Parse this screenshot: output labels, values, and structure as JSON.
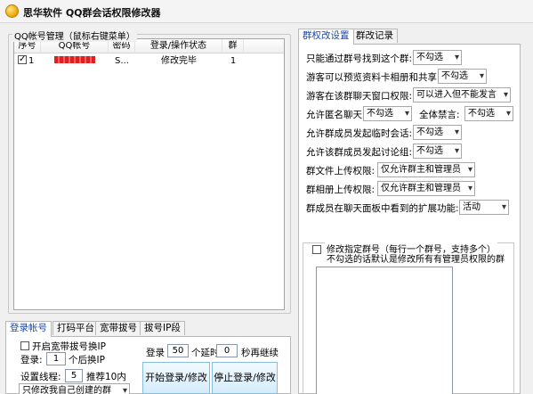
{
  "window": {
    "title": "思华软件 QQ群会话权限修改器",
    "icon": "app-logo-icon"
  },
  "accounts": {
    "group_title": "QQ帐号管理（鼠标右键菜单）",
    "columns": [
      "序号",
      "QQ帐号",
      "密码",
      "登录/操作状态",
      "群"
    ],
    "rows": [
      {
        "index": "1",
        "checked": true,
        "account": "(redacted)",
        "password": "S...",
        "status": "修改完毕",
        "groups": "1"
      }
    ]
  },
  "bottom_tabs": {
    "tabs": [
      "登录帐号",
      "打码平台",
      "宽带拔号",
      "拔号IP段"
    ],
    "active": 0,
    "dial_checkbox_label": "开启宽带拔号换IP",
    "login_label": "登录:",
    "login_value": "1",
    "login_suffix": "个后换IP",
    "threads_label": "设置线程:",
    "threads_value": "5",
    "threads_hint": "推荐10内",
    "group_scope_select": "只修改我自己创建的群",
    "login_count_label": "登录",
    "login_count_value": "50",
    "delay_label": "个延时",
    "delay_value": "0",
    "delay_suffix": "秒再继续",
    "start_button": "开始登录/修改",
    "stop_button": "停止登录/修改"
  },
  "settings": {
    "tabs": [
      "群权改设置",
      "群改记录"
    ],
    "active": 0,
    "items": [
      {
        "label": "只能通过群号找到这个群:",
        "value": "不勾选"
      },
      {
        "label": "游客可以预览资料卡相册和共享:",
        "value": "不勾选"
      },
      {
        "label": "游客在该群聊天窗口权限:",
        "value": "可以进入但不能发言"
      },
      {
        "label": "允许匿名聊天:",
        "value": "不勾选",
        "label2": "全体禁言:",
        "value2": "不勾选"
      },
      {
        "label": "允许群成员发起临时会话:",
        "value": "不勾选"
      },
      {
        "label": "允许该群成员发起讨论组:",
        "value": "不勾选"
      },
      {
        "label": "群文件上传权限:",
        "value": "仅允许群主和管理员"
      },
      {
        "label": "群相册上传权限:",
        "value": "仅允许群主和管理员"
      },
      {
        "label": "群成员在聊天面板中看到的扩展功能:",
        "value": "活动"
      }
    ],
    "specific_group_checkbox": "修改指定群号（每行一个群号，支持多个）",
    "specific_group_hint": "不勾选的话默认是修改所有有管理员权限的群"
  }
}
